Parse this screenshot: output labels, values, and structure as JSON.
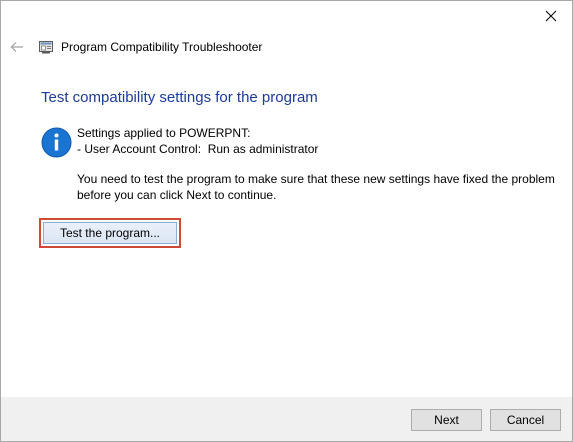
{
  "window": {
    "title": "Program Compatibility Troubleshooter",
    "close_icon": "close-icon",
    "back_icon": "back-arrow-icon"
  },
  "main": {
    "heading": "Test compatibility settings for the program",
    "info_icon": "info-icon",
    "settings_line1": "Settings applied to POWERPNT:",
    "settings_line2": "- User Account Control:  Run as administrator",
    "description_line1": "You need to test the program to make sure that these new settings have fixed the problem",
    "description_line2": "before you can click Next to continue.",
    "test_button_label": "Test the program..."
  },
  "footer": {
    "next_label": "Next",
    "cancel_label": "Cancel"
  },
  "colors": {
    "heading": "#1b3b9c",
    "highlight_border": "#cf4a35",
    "info_icon": "#1a74d2",
    "footer_bg": "#f0f0f0"
  }
}
